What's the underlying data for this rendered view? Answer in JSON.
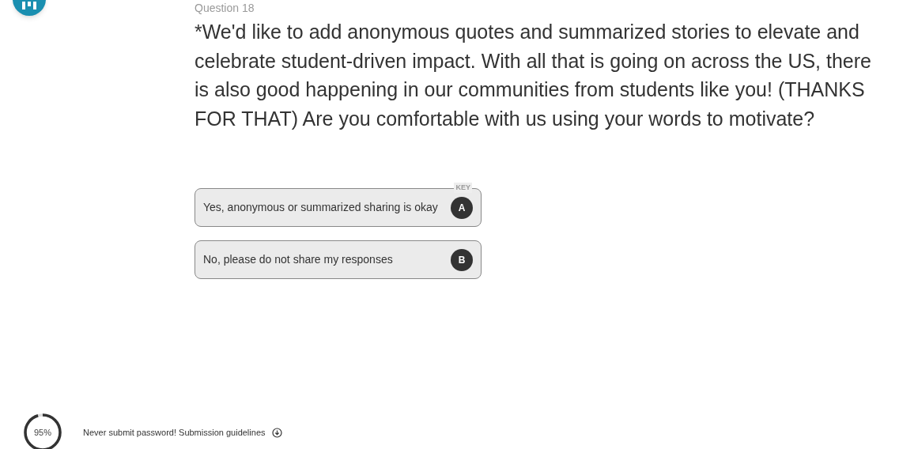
{
  "question": {
    "number": "Question 18",
    "text": "*We'd like to add anonymous quotes and summarized stories to elevate and celebrate student-driven impact. With all that is going on across the US, there is also good happening in our communities from students like you! (THANKS FOR THAT) Are you comfortable with us using your words to motivate?"
  },
  "key_hint": "KEY",
  "options": [
    {
      "label": "Yes, anonymous or summarized sharing is okay",
      "key": "A",
      "selected": false
    },
    {
      "label": "No, please do not share my responses",
      "key": "B",
      "selected": false
    }
  ],
  "footer": {
    "progress": {
      "level": 0.95,
      "reading": "95%"
    },
    "notice": "Never submit password! Submission guidelines"
  }
}
